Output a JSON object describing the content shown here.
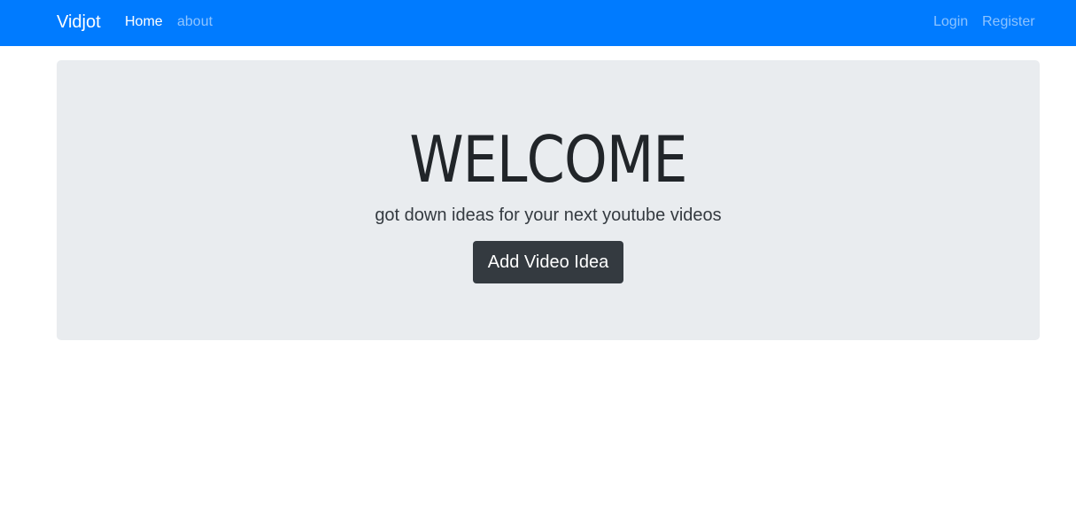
{
  "navbar": {
    "brand": "Vidjot",
    "left_links": [
      {
        "label": "Home",
        "active": true
      },
      {
        "label": "about",
        "active": false
      }
    ],
    "right_links": [
      {
        "label": "Login"
      },
      {
        "label": "Register"
      }
    ],
    "background_color": "#007bff"
  },
  "jumbotron": {
    "heading": "WELCOME",
    "lead": "got down ideas for your next youtube videos",
    "button_label": "Add Video Idea",
    "background_color": "#e9ecef",
    "button_color": "#343a40"
  }
}
